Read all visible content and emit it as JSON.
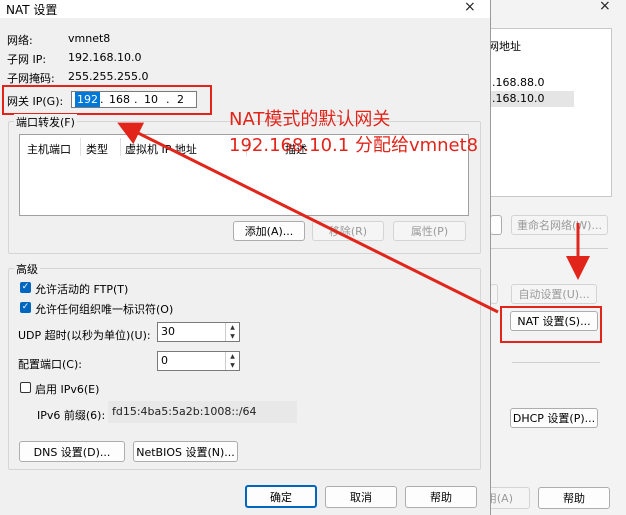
{
  "window": {
    "title": "NAT 设置",
    "close_glyph": "×"
  },
  "network": {
    "label": "网络:",
    "value": "vmnet8",
    "subnet_ip_label": "子网 IP:",
    "subnet_ip": "192.168.10.0",
    "mask_label": "子网掩码:",
    "mask": "255.255.255.0"
  },
  "gateway": {
    "label": "网关 IP(G):",
    "octets": [
      "192",
      "168",
      "10",
      "2"
    ]
  },
  "port_forwarding": {
    "group_label": "端口转发(F)",
    "columns": [
      "主机端口",
      "类型",
      "虚拟机 IP 地址",
      "描述"
    ],
    "add": "添加(A)...",
    "remove": "移除(R)",
    "properties": "属性(P)"
  },
  "advanced": {
    "group_label": "高级",
    "allow_ftp": "允许活动的 FTP(T)",
    "allow_oui": "允许任何组织唯一标识符(O)",
    "udp_label": "UDP 超时(以秒为单位)(U):",
    "udp_value": "30",
    "config_port_label": "配置端口(C):",
    "config_port_value": "0",
    "ipv6_enable": "启用 IPv6(E)",
    "ipv6_prefix_label": "IPv6 前缀(6):",
    "ipv6_prefix": "fd15:4ba5:5a2b:1008::/64",
    "dns": "DNS 设置(D)...",
    "netbios": "NetBIOS 设置(N)..."
  },
  "footer": {
    "ok": "确定",
    "cancel": "取消",
    "help": "帮助"
  },
  "background_dialog": {
    "close_glyph": "×",
    "list_header": "网地址",
    "rows": [
      ".168.88.0",
      ".168.10.0"
    ],
    "rename": "重命名网络(W)...",
    "auto": "自动设置(U)...",
    "nat": "NAT 设置(S)...",
    "dhcp": "DHCP 设置(P)...",
    "apply_partial": "用(A)",
    "help": "帮助"
  },
  "annotation": {
    "line1": "NAT模式的默认网关",
    "line2": "192.168.10.1 分配给vmnet8",
    "color": "#e1251b"
  }
}
